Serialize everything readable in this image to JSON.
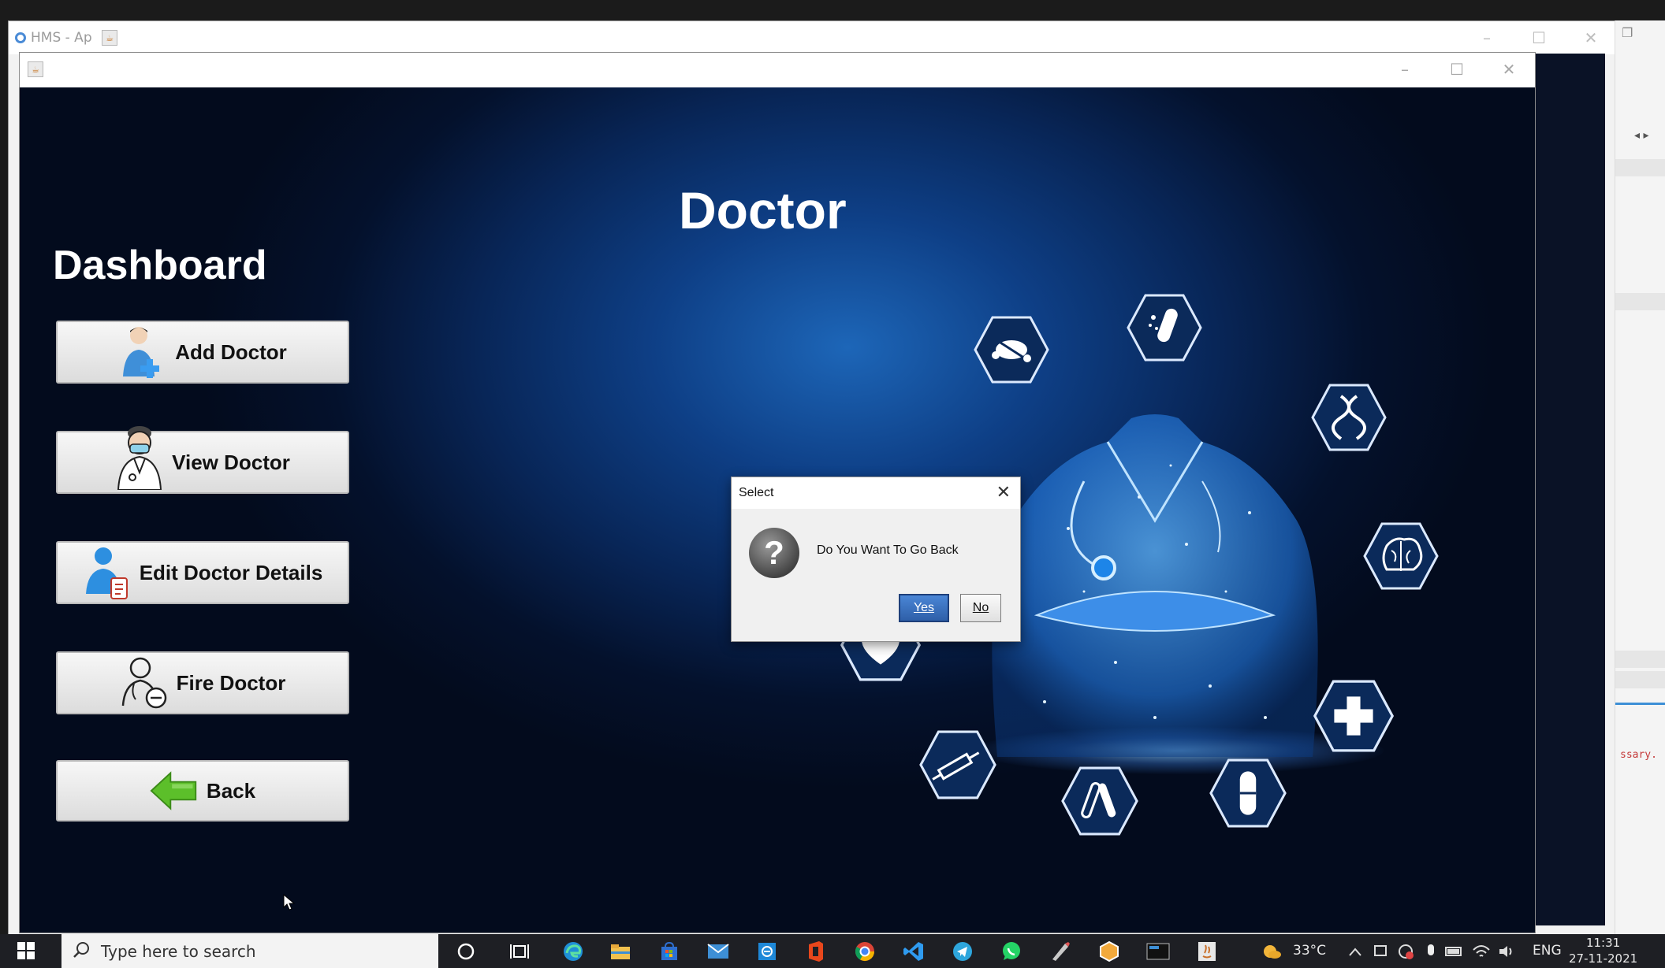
{
  "outer_window": {
    "title": "HMS - Ap",
    "restore_glyph": "❐"
  },
  "side_panel": {
    "code_fragment": "ssary."
  },
  "app_window": {
    "controls": {
      "minimize": "–",
      "maximize": "☐",
      "close": "✕"
    }
  },
  "page_title": "Doctor",
  "dashboard": {
    "title": "Dashboard",
    "buttons": [
      {
        "label": "Add Doctor",
        "icon": "add-doctor-icon"
      },
      {
        "label": "View Doctor",
        "icon": "view-doctor-icon"
      },
      {
        "label": "Edit Doctor Details",
        "icon": "edit-doctor-icon"
      },
      {
        "label": "Fire Doctor",
        "icon": "fire-doctor-icon"
      },
      {
        "label": "Back",
        "icon": "back-arrow-icon"
      }
    ]
  },
  "dialog": {
    "title": "Select",
    "message": "Do You Want To Go Back",
    "yes_label": "Yes",
    "no_label": "No",
    "icon": "question-icon"
  },
  "taskbar": {
    "search_placeholder": "Type here to search",
    "weather": "33°C",
    "language": "ENG",
    "time": "11:31",
    "date": "27-11-2021"
  },
  "colors": {
    "canvas_dark": "#030b1d",
    "canvas_glow": "#1d66b8",
    "yes_button": "#2e5fa8",
    "button_face": "#e8e8e8",
    "taskbar": "#1e1f24"
  }
}
